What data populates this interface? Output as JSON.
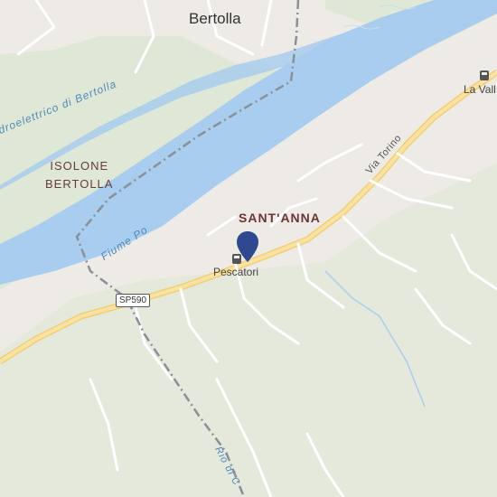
{
  "map": {
    "labels": {
      "town": "Bertolla",
      "island": "ISOLONE\nBERTOLLA",
      "district": "SANT'ANNA",
      "stop_main": "Pescatori",
      "stop_ne": "La Vall",
      "river": "Fiume Po",
      "canal": "idroelettrico di Bertolla",
      "road_route": "SP590",
      "road_street": "Via Torino",
      "stream": "Rio di C"
    },
    "colors": {
      "water": "#a9cdee",
      "land": "#eeebe6",
      "park": "#dfe8d6",
      "road_major": "#f7dc93",
      "road_minor": "#ffffff",
      "boundary": "#8a8f9a",
      "pin": "#2f4890"
    },
    "icons": [
      "bus-stop-icon",
      "map-pin-icon"
    ]
  }
}
